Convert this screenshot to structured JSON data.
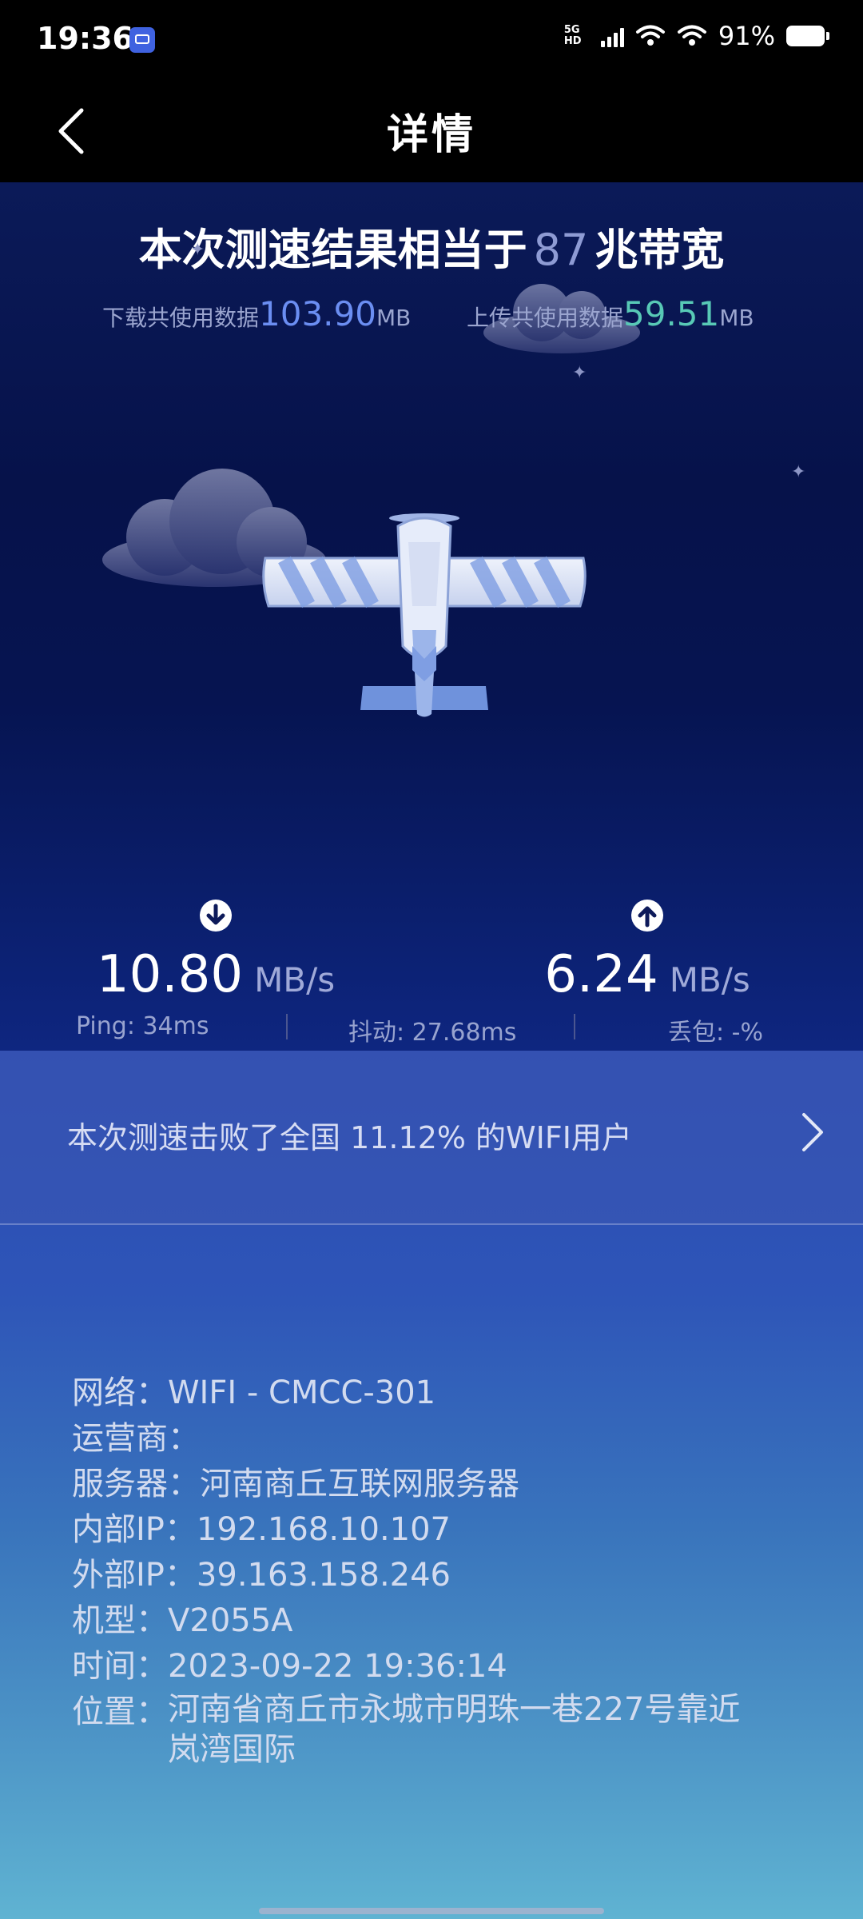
{
  "status_bar": {
    "time": "19:36",
    "network_label": "5G HD",
    "battery": "91%"
  },
  "header": {
    "title": "详情"
  },
  "summary": {
    "headline_prefix": "本次测速结果相当于",
    "bandwidth_value": "87",
    "headline_suffix": "兆带宽",
    "download_usage_label": "下载共使用数据",
    "download_usage_value": "103.90",
    "download_usage_unit": "MB",
    "upload_usage_label": "上传共使用数据",
    "upload_usage_value": "59.51",
    "upload_usage_unit": "MB"
  },
  "speeds": {
    "download_value": "10.80",
    "download_unit": "MB/s",
    "upload_value": "6.24",
    "upload_unit": "MB/s"
  },
  "metrics": {
    "ping": "Ping: 34ms",
    "jitter": "抖动: 27.68ms",
    "loss": "丢包: -%"
  },
  "ranking": {
    "text": "本次测速击败了全国 11.12% 的WIFI用户"
  },
  "details": {
    "network_label": "网络：",
    "network_value": "WIFI - CMCC-301",
    "carrier_label": "运营商：",
    "carrier_value": "",
    "server_label": "服务器：",
    "server_value": "河南商丘互联网服务器",
    "internal_ip_label": "内部IP：",
    "internal_ip_value": "192.168.10.107",
    "external_ip_label": "外部IP：",
    "external_ip_value": "39.163.158.246",
    "model_label": "机型：",
    "model_value": "V2055A",
    "time_label": "时间：",
    "time_value": "2023-09-22 19:36:14",
    "location_label": "位置：",
    "location_value": "河南省商丘市永城市明珠一巷227号靠近\n岚湾国际"
  },
  "colors": {
    "download_accent": "#6b8ef2",
    "upload_accent": "#58c9b6",
    "sky_top": "#0b1a58",
    "panel_bottom": "#5fb3d2"
  },
  "icons": {
    "back": "chevron-left-icon",
    "ranking_arrow": "chevron-right-icon",
    "download": "arrow-down-circle-icon",
    "upload": "arrow-up-circle-icon"
  }
}
